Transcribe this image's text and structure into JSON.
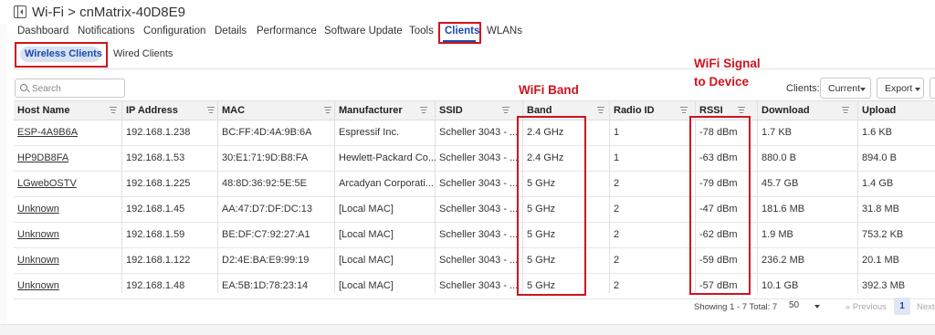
{
  "header": {
    "title": "Wi-Fi > cnMatrix-40D8E9"
  },
  "tabs": [
    {
      "label": "Dashboard"
    },
    {
      "label": "Notifications"
    },
    {
      "label": "Configuration"
    },
    {
      "label": "Details"
    },
    {
      "label": "Performance"
    },
    {
      "label": "Software Update"
    },
    {
      "label": "Tools"
    },
    {
      "label": "Clients",
      "active": true
    },
    {
      "label": "WLANs"
    }
  ],
  "subtabs": [
    {
      "label": "Wireless Clients",
      "active": true
    },
    {
      "label": "Wired Clients"
    }
  ],
  "search": {
    "placeholder": "Search"
  },
  "annotations": {
    "band": "WiFi Band",
    "signal_line1": "WiFi Signal",
    "signal_line2": "to Device"
  },
  "toolbar": {
    "clients_label": "Clients:",
    "clients_value": "Current",
    "export_label": "Export"
  },
  "columns": [
    "Host Name",
    "IP Address",
    "MAC",
    "Manufacturer",
    "SSID",
    "Band",
    "Radio ID",
    "RSSI",
    "Download",
    "Upload"
  ],
  "rows": [
    [
      "ESP-4A9B6A",
      "192.168.1.238",
      "BC:FF:4D:4A:9B:6A",
      "Espressif Inc.",
      "Scheller 3043 - ...",
      "2.4 GHz",
      "1",
      "-78 dBm",
      "1.7 KB",
      "1.6 KB"
    ],
    [
      "HP9DB8FA",
      "192.168.1.53",
      "30:E1:71:9D:B8:FA",
      "Hewlett-Packard Co...",
      "Scheller 3043 - ...",
      "2.4 GHz",
      "1",
      "-63 dBm",
      "880.0 B",
      "894.0 B"
    ],
    [
      "LGwebOSTV",
      "192.168.1.225",
      "48:8D:36:92:5E:5E",
      "Arcadyan Corporati...",
      "Scheller 3043 - ...",
      "5 GHz",
      "2",
      "-79 dBm",
      "45.7 GB",
      "1.4 GB"
    ],
    [
      "Unknown",
      "192.168.1.45",
      "AA:47:D7:DF:DC:13",
      "[Local MAC]",
      "Scheller 3043 - ...",
      "5 GHz",
      "2",
      "-47 dBm",
      "181.6 MB",
      "31.8 MB"
    ],
    [
      "Unknown",
      "192.168.1.59",
      "BE:DF:C7:92:27:A1",
      "[Local MAC]",
      "Scheller 3043 - ...",
      "5 GHz",
      "2",
      "-62 dBm",
      "1.9 MB",
      "753.2 KB"
    ],
    [
      "Unknown",
      "192.168.1.122",
      "D2:4E:BA:E9:99:19",
      "[Local MAC]",
      "Scheller 3043 - ...",
      "5 GHz",
      "2",
      "-59 dBm",
      "236.2 MB",
      "20.1 MB"
    ],
    [
      "Unknown",
      "192.168.1.48",
      "EA:5B:1D:78:23:14",
      "[Local MAC]",
      "Scheller 3043 - ...",
      "5 GHz",
      "2",
      "-57 dBm",
      "10.1 GB",
      "392.3 MB"
    ]
  ],
  "footer": {
    "showing": "Showing 1 - 7 Total: 7",
    "page_size": "50",
    "prev": "« Previous",
    "page": "1",
    "next": "Next"
  },
  "colors": {
    "accent": "#1b4aa8",
    "annotation_red": "#d0141e"
  }
}
